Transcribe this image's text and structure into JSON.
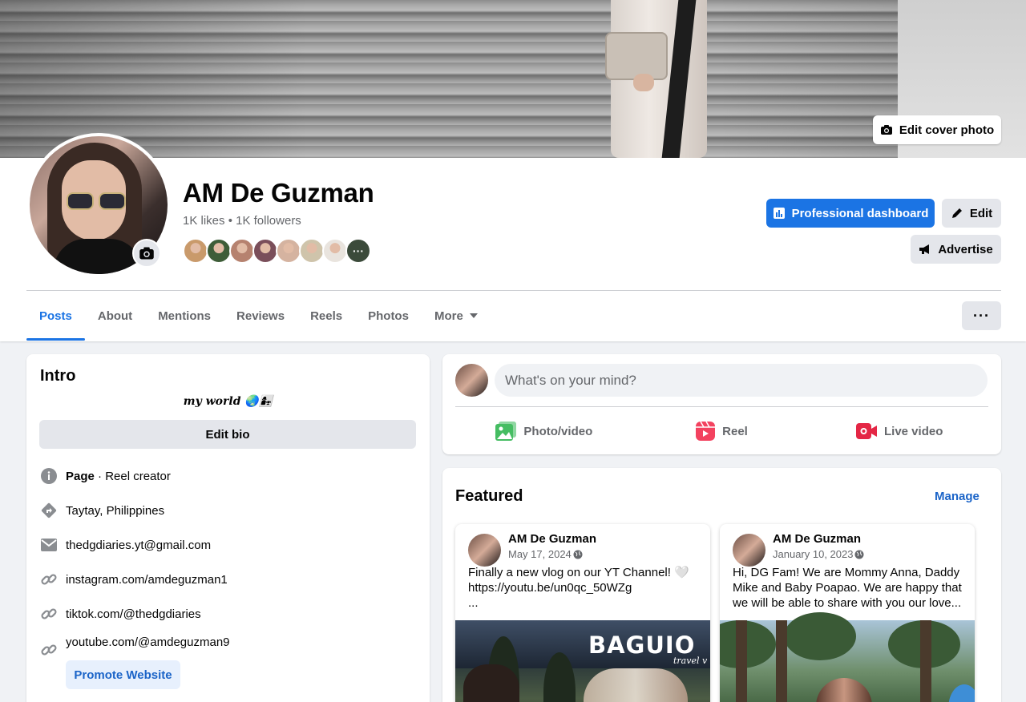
{
  "cover": {
    "edit_label": "Edit cover photo"
  },
  "profile": {
    "name": "AM De Guzman",
    "stats": "1K likes • 1K followers",
    "friend_avatar_colors": [
      "#c99a6b",
      "#3e5d38",
      "#b6826f",
      "#7a4e5a",
      "#d5b3a0",
      "#cfc4ab",
      "#e9e4de",
      "#3b4a3a"
    ],
    "friends_more": "···"
  },
  "actions": {
    "professional_dashboard": "Professional dashboard",
    "edit": "Edit",
    "advertise": "Advertise",
    "more": "···"
  },
  "tabs": [
    {
      "label": "Posts",
      "active": true
    },
    {
      "label": "About"
    },
    {
      "label": "Mentions"
    },
    {
      "label": "Reviews"
    },
    {
      "label": "Reels"
    },
    {
      "label": "Photos"
    },
    {
      "label": "More"
    }
  ],
  "intro": {
    "title": "Intro",
    "bio": "my world 🌏👩‍👧",
    "edit_bio": "Edit bio",
    "page_label": "Page",
    "page_category": " · Reel creator",
    "location": "Taytay, Philippines",
    "email": "thedgdiaries.yt@gmail.com",
    "links": [
      "instagram.com/amdeguzman1",
      "tiktok.com/@thedgdiaries",
      "youtube.com/@amdeguzman9"
    ],
    "promote": "Promote Website"
  },
  "composer": {
    "placeholder": "What's on your mind?",
    "photo_video": "Photo/video",
    "reel": "Reel",
    "live_video": "Live video"
  },
  "featured": {
    "title": "Featured",
    "manage": "Manage",
    "items": [
      {
        "author": "AM De Guzman",
        "date": "May 17, 2024",
        "text": "Finally a new vlog on our YT Channel! 🤍\nhttps://youtu.be/un0qc_50WZg\n...",
        "overlay_title": "BAGUIO",
        "overlay_script": "travel v"
      },
      {
        "author": "AM De Guzman",
        "date": "January 10, 2023",
        "text": "Hi, DG Fam! We are Mommy Anna, Daddy Mike and Baby Poapao. We are happy that we will be able to share with you our love..."
      }
    ]
  },
  "colors": {
    "accent": "#1b74e4",
    "text_secondary": "#65676b",
    "background": "#f0f2f5"
  }
}
